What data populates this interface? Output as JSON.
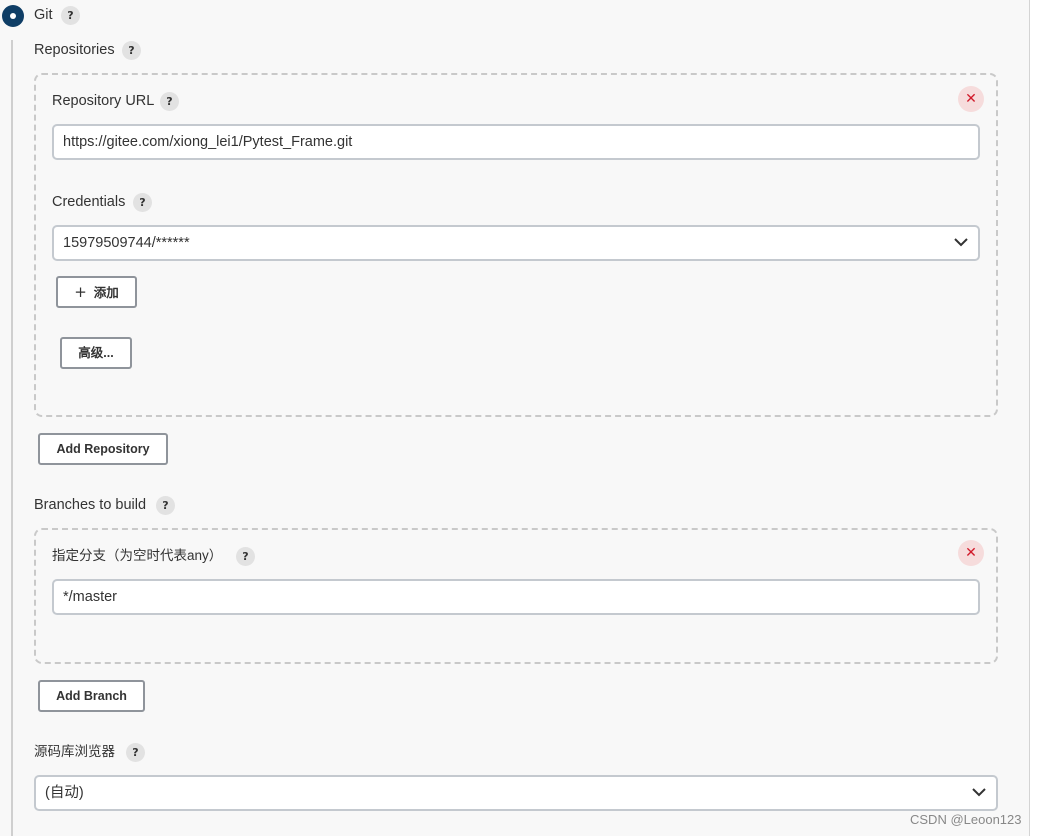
{
  "scm": {
    "option_label": "Git",
    "help_glyph": "?"
  },
  "repositories": {
    "label": "Repositories",
    "items": [
      {
        "url_label": "Repository URL",
        "url_value": "https://gitee.com/xiong_lei1/Pytest_Frame.git",
        "credentials_label": "Credentials",
        "credentials_value": "15979509744/******",
        "add_button_label": "添加",
        "advanced_button_label": "高级..."
      }
    ],
    "add_button_label": "Add Repository",
    "remove_glyph": "✕"
  },
  "branches": {
    "label": "Branches to build",
    "items": [
      {
        "specifier_label": "指定分支（为空时代表any）",
        "specifier_value": "*/master"
      }
    ],
    "add_button_label": "Add Branch"
  },
  "browser": {
    "label": "源码库浏览器",
    "value": "(自动)"
  },
  "watermark": "CSDN @Leoon123",
  "colors": {
    "radio_selected": "#0f3e66",
    "remove_icon": "#d11a2a",
    "remove_bg": "#f6dcdc"
  },
  "icons": {
    "radio": "radio-selected-icon",
    "help": "help-icon",
    "remove": "close-icon",
    "dropdown": "chevron-down-icon",
    "add": "plus-icon"
  }
}
